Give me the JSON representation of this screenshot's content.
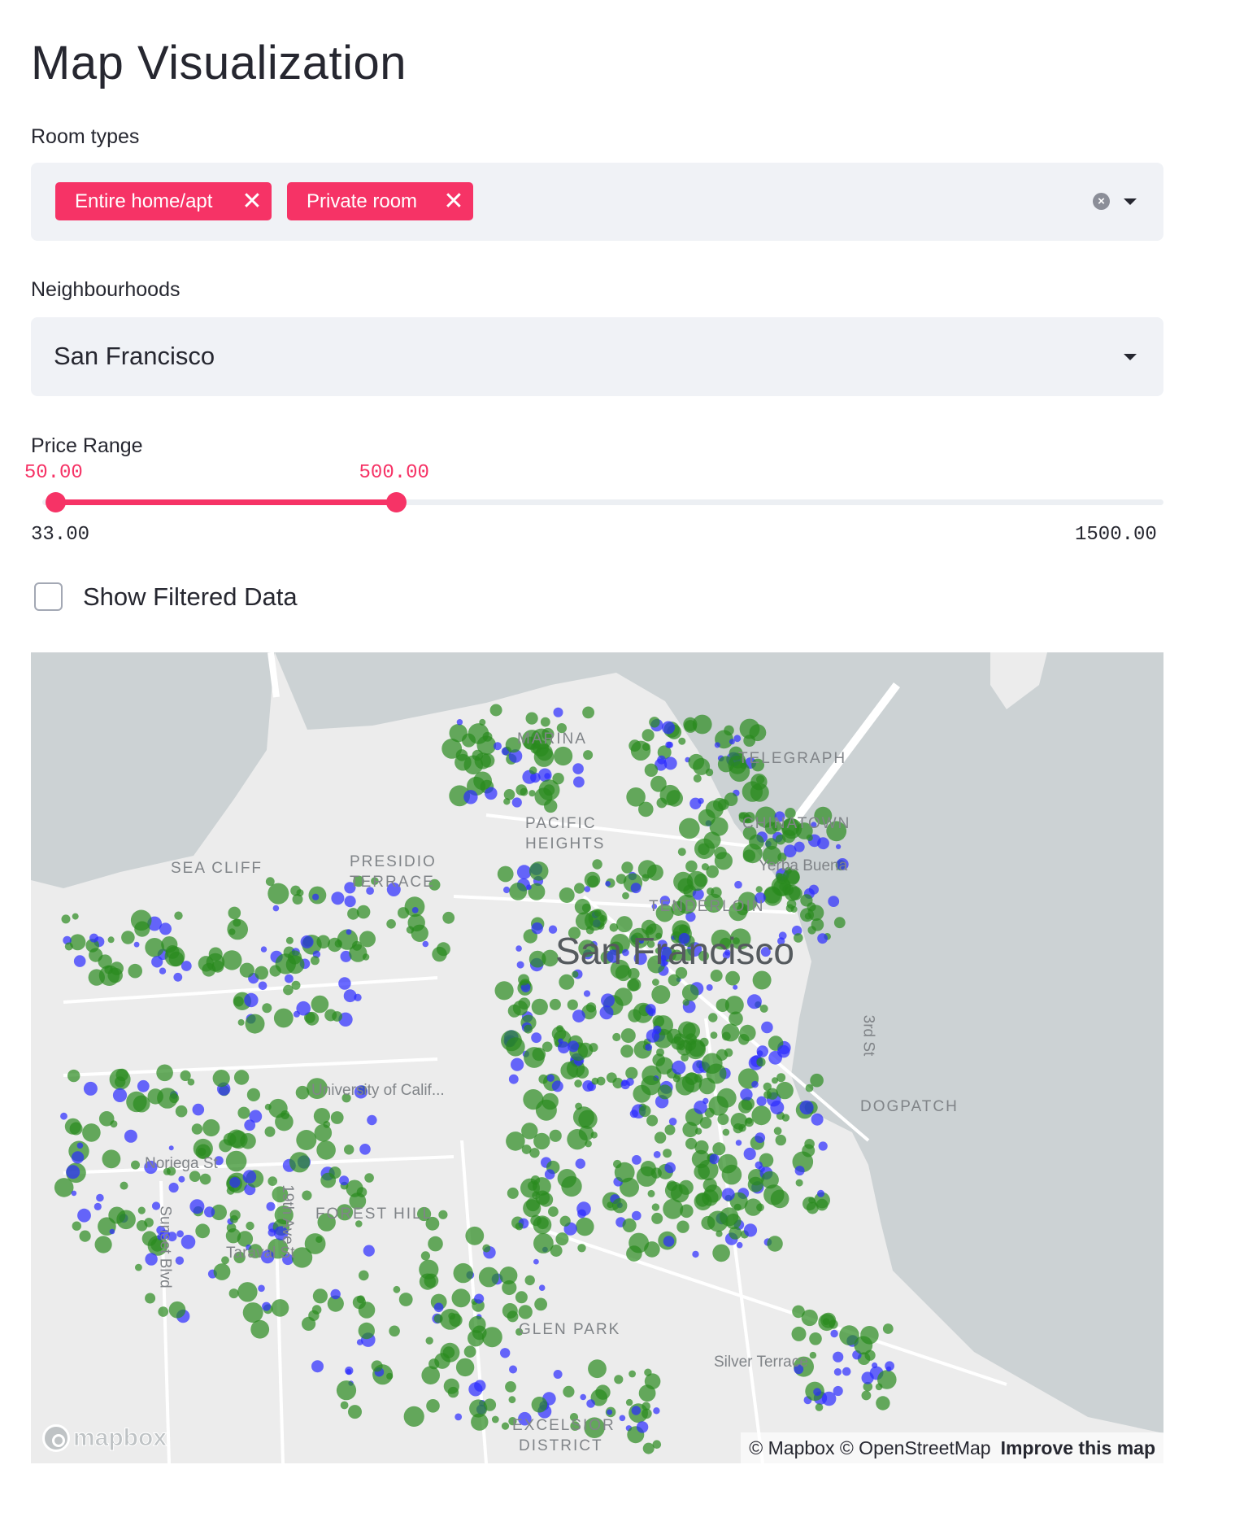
{
  "page": {
    "title": "Map Visualization"
  },
  "room_types": {
    "label": "Room types",
    "selected": [
      "Entire home/apt",
      "Private room"
    ],
    "remove_glyph": "✕",
    "clear_glyph": "×"
  },
  "neighbourhoods": {
    "label": "Neighbourhoods",
    "value": "San Francisco"
  },
  "price_range": {
    "label": "Price Range",
    "low": "50.00",
    "high": "500.00",
    "min": "33.00",
    "max": "1500.00",
    "low_value": 50,
    "high_value": 500,
    "min_value": 33,
    "max_value": 1500
  },
  "show_filtered": {
    "label": "Show Filtered Data",
    "checked": false
  },
  "map": {
    "city_label": "San Francisco",
    "area_labels": [
      "SEA CLIFF",
      "PRESIDIO",
      "TERRACE",
      "PACIFIC",
      "HEIGHTS",
      "TENDERLOIN",
      "FOREST HILL",
      "Silver Terrace",
      "EXCELSIOR",
      "DISTRICT",
      "University of Calif...",
      "Noriega St",
      "Taraval St",
      "Sunset Blvd",
      "19th Ave",
      "3rd St",
      "CHINATOWN",
      "Yerba Buena",
      "MARINA",
      "TELEGRAPH",
      "GLEN PARK",
      "DOGPATCH"
    ],
    "attribution": "© Mapbox © OpenStreetMap",
    "improve_link": "Improve this map",
    "logo_text": "mapbox",
    "colors": {
      "entire_home": "#2a8a1e",
      "private_room": "#2b2bff",
      "water": "#ccd2d4",
      "land": "#ececec"
    }
  }
}
